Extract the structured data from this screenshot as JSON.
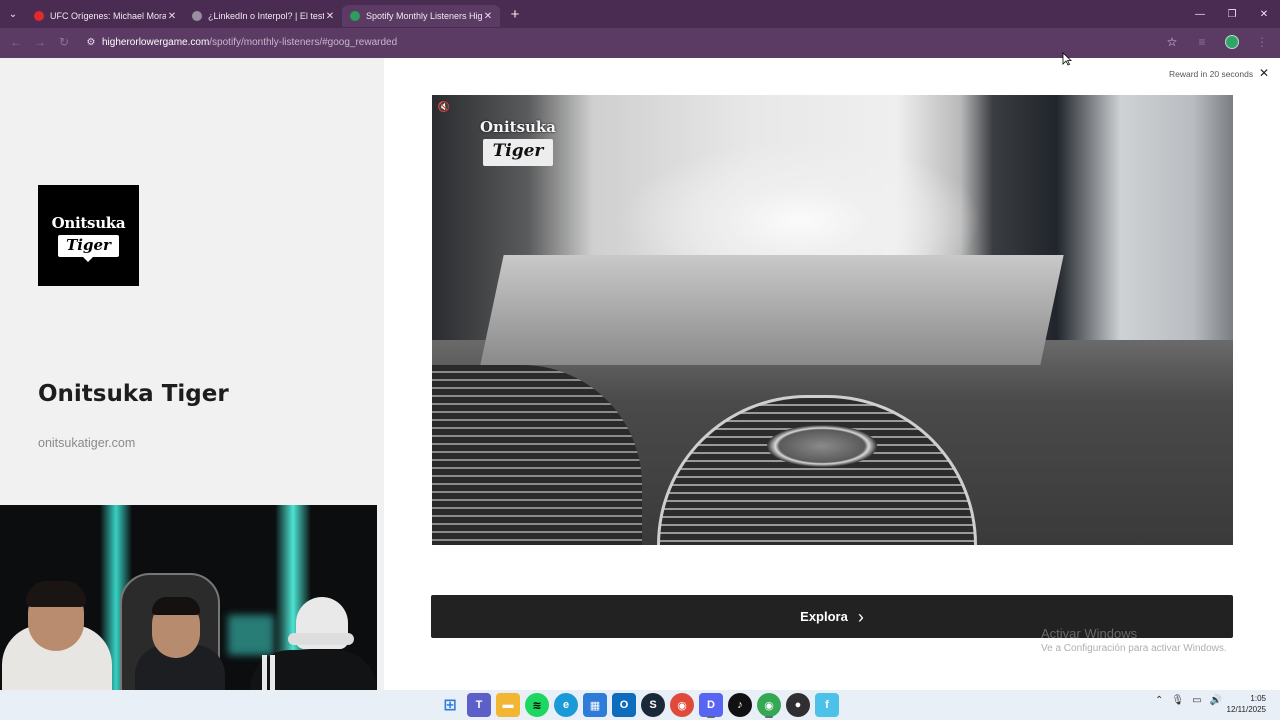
{
  "browser": {
    "tabs": [
      {
        "title": "UFC Orígenes: Michael Morales",
        "favicon_color": "#e12b2b",
        "active": false
      },
      {
        "title": "¿LinkedIn o Interpol? | El test m",
        "favicon_color": "#9a8fa0",
        "active": false
      },
      {
        "title": "Spotify Monthly Listeners High",
        "favicon_color": "#2e9c5b",
        "active": true
      }
    ],
    "url_host": "higherorlowergame.com",
    "url_path": "/spotify/monthly-listeners/#goog_rewarded"
  },
  "brand_panel": {
    "logo_line1": "Onitsuka",
    "logo_line2": "Tiger",
    "name": "Onitsuka Tiger",
    "url": "onitsukatiger.com"
  },
  "ad": {
    "reward_text": "Reward in 20 seconds",
    "video_logo_line1": "Onitsuka",
    "video_logo_line2": "Tiger",
    "cta_label": "Explora"
  },
  "watermark": {
    "line1": "Activar Windows",
    "line2": "Ve a Configuración para activar Windows."
  },
  "taskbar": {
    "apps": [
      {
        "name": "windows-start",
        "color": "#2b7de1",
        "glyph": "⊞"
      },
      {
        "name": "teams",
        "color": "#5b5fc7",
        "glyph": "T"
      },
      {
        "name": "file-explorer",
        "color": "#f2b632",
        "glyph": "▬"
      },
      {
        "name": "spotify",
        "color": "#1ed760",
        "glyph": "≋"
      },
      {
        "name": "edge",
        "color": "#1a9bd7",
        "glyph": "e"
      },
      {
        "name": "store",
        "color": "#2f7bd8",
        "glyph": "▦"
      },
      {
        "name": "outlook",
        "color": "#0f6cbd",
        "glyph": "O"
      },
      {
        "name": "steam",
        "color": "#1b2838",
        "glyph": "S"
      },
      {
        "name": "chrome",
        "color": "#e04a3a",
        "glyph": "◉"
      },
      {
        "name": "discord",
        "color": "#5865f2",
        "glyph": "D"
      },
      {
        "name": "tiktok",
        "color": "#111111",
        "glyph": "♪"
      },
      {
        "name": "chrome-profile",
        "color": "#34a853",
        "glyph": "◉"
      },
      {
        "name": "obs",
        "color": "#302e31",
        "glyph": "●"
      },
      {
        "name": "app-f",
        "color": "#4cc2e8",
        "glyph": "f"
      }
    ],
    "time": "1:05",
    "date": "12/11/2025"
  }
}
